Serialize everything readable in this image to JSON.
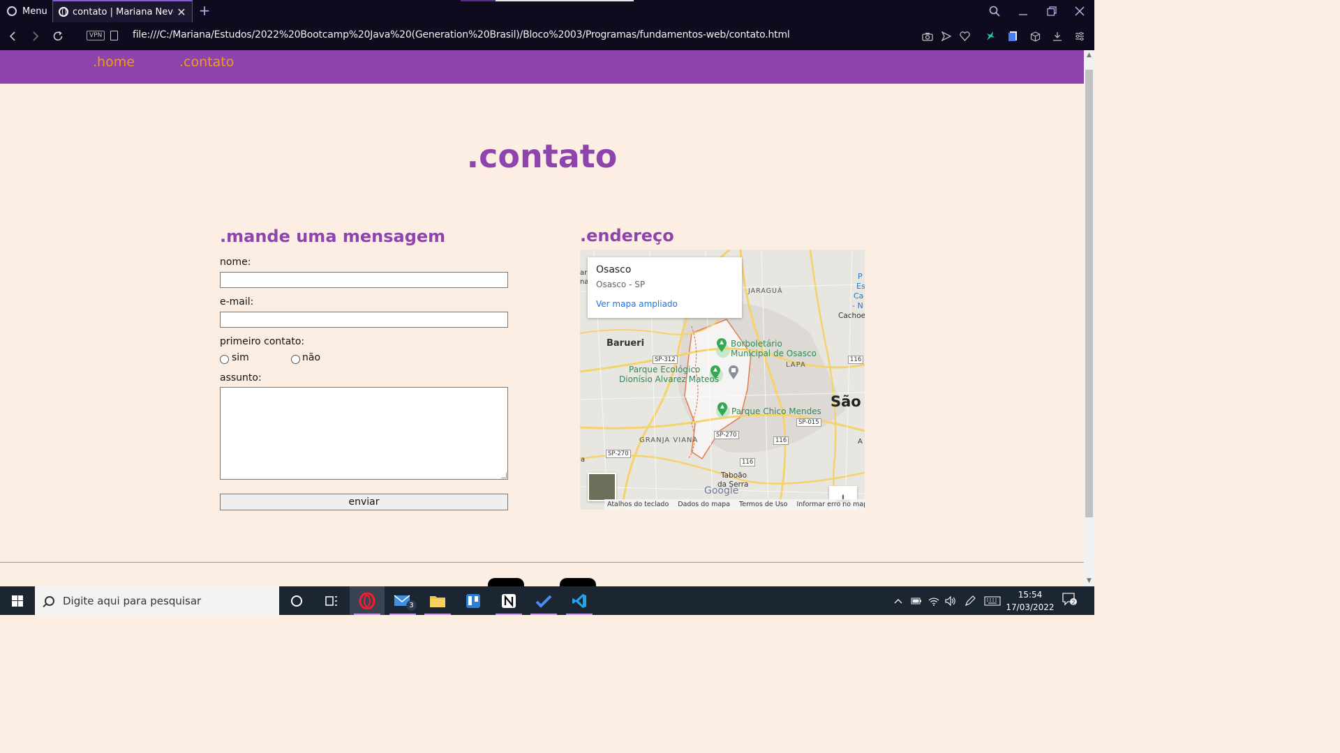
{
  "browser": {
    "menu_label": "Menu",
    "tab_title": "contato | Mariana Neves",
    "url": "file:///C:/Mariana/Estudos/2022%20Bootcamp%20Java%20(Generation%20Brasil)/Bloco%2003/Programas/fundamentos-web/contato.html",
    "vpn_label": "VPN"
  },
  "site": {
    "nav": [
      ".home",
      ".contato"
    ],
    "title": ".contato",
    "form": {
      "heading": ".mande uma mensagem",
      "name_label": "nome:",
      "email_label": "e-mail:",
      "first_contact_label": "primeiro contato:",
      "option_yes": "sim",
      "option_no": "não",
      "subject_label": "assunto:",
      "submit_label": "enviar",
      "name_value": "",
      "email_value": "",
      "subject_value": ""
    },
    "address_heading": ".endereço",
    "colors": {
      "purple": "#8e44ad",
      "orange": "#f39c12",
      "background": "#fdeee4"
    }
  },
  "map": {
    "card_place": "Osasco",
    "card_sub": "Osasco - SP",
    "card_link": "Ver mapa ampliado",
    "labels": {
      "barueri": "Barueri",
      "jaragua": "JARAGUÁ",
      "cachoeirinha": "Cachoeirin",
      "borboletario_1": "Borboletário",
      "borboletario_2": "Municipal de Osasco",
      "lapa": "LAPA",
      "parque_eco_1": "Parque Ecológico",
      "parque_eco_2": "Dionísio Alvarez Mateos",
      "sao": "São",
      "parque_chico": "Parque Chico Mendes",
      "granja": "GRANJA VIANA",
      "taboao_1": "Taboão",
      "taboao_2": "da Serra",
      "edge_left_1": "ar",
      "edge_left_2": "na",
      "edge_left_3": "a",
      "edge_right_1": "P",
      "edge_right_2": "Es",
      "edge_right_3": "Ca",
      "edge_right_4": "- N",
      "edge_right_5": "A"
    },
    "shields": [
      "SP-312",
      "116",
      "SP-015",
      "SP-270",
      "SP-270",
      "116",
      "116"
    ],
    "zoom_in": "+",
    "zoom_out": "−",
    "google": "Google",
    "footer": [
      "Atalhos do teclado",
      "Dados do mapa",
      "Termos de Uso",
      "Informar erro no mapa"
    ]
  },
  "taskbar": {
    "search_placeholder": "Digite aqui para pesquisar",
    "mail_badge": "3",
    "time": "15:54",
    "date": "17/03/2022"
  }
}
